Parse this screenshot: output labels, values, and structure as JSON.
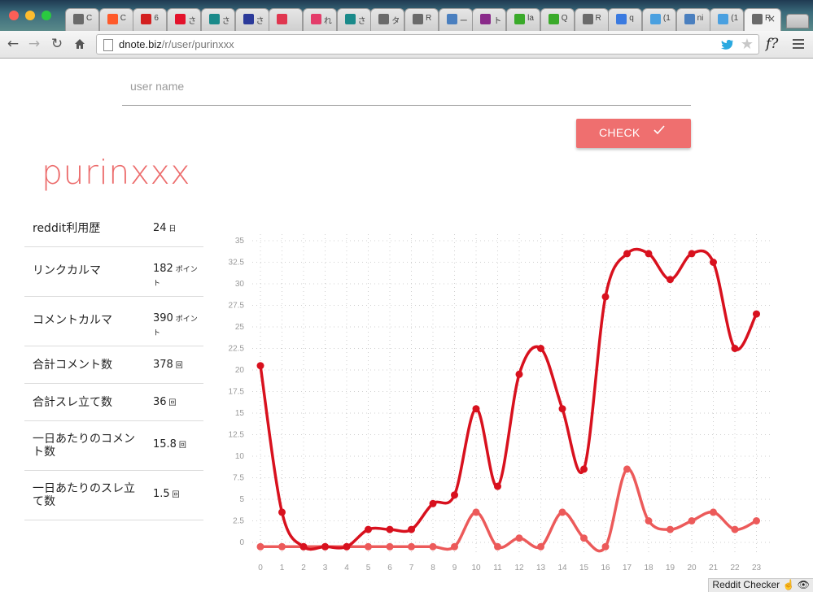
{
  "browser": {
    "tabs": [
      {
        "title": "C",
        "color": "#6a6a6a",
        "icon": "doc-icon"
      },
      {
        "title": "C",
        "color": "#ff5a2a",
        "icon": "slideshare-icon"
      },
      {
        "title": "6",
        "color": "#d31f1f",
        "icon": "flipboard-icon"
      },
      {
        "title": "さ",
        "color": "#e3122b",
        "icon": "red-square-icon"
      },
      {
        "title": "さ",
        "color": "#1a8a8a",
        "icon": "hatena-icon"
      },
      {
        "title": "さ",
        "color": "#2b3a9a",
        "icon": "stripe-icon"
      },
      {
        "title": "",
        "color": "#e0364f",
        "icon": "close-circle-icon"
      },
      {
        "title": "れ",
        "color": "#e43c6a",
        "icon": "bird-icon"
      },
      {
        "title": "さ",
        "color": "#1a8a8a",
        "icon": "hatena-icon"
      },
      {
        "title": "タ",
        "color": "#6a6a6a",
        "icon": "doc-icon"
      },
      {
        "title": "R",
        "color": "#6a6a6a",
        "icon": "doc-icon"
      },
      {
        "title": "ー",
        "color": "#4a7fbf",
        "icon": "reddit-icon"
      },
      {
        "title": "ト",
        "color": "#8a2a8a",
        "icon": "bars-icon"
      },
      {
        "title": "la",
        "color": "#3aaa2a",
        "icon": "qiita-icon"
      },
      {
        "title": "Q",
        "color": "#3aaa2a",
        "icon": "qiita-icon"
      },
      {
        "title": "R",
        "color": "#6a6a6a",
        "icon": "doc-icon"
      },
      {
        "title": "q",
        "color": "#3a7ae0",
        "icon": "google-icon"
      },
      {
        "title": "(1",
        "color": "#4aa0e0",
        "icon": "twitter-icon"
      },
      {
        "title": "ni",
        "color": "#4a7fbf",
        "icon": "reddit-icon"
      },
      {
        "title": "(1",
        "color": "#4aa0e0",
        "icon": "twitter-icon"
      },
      {
        "title": "R",
        "color": "#6a6a6a",
        "icon": "doc-icon",
        "active": true
      }
    ],
    "url_host": "dnote.biz",
    "url_path": "/r/user/purinxxx",
    "ext_label": "f?"
  },
  "form": {
    "placeholder": "user name",
    "value": "",
    "check_label": "CHECK"
  },
  "username": "purinxxx",
  "stats": [
    {
      "label": "reddit利用歴",
      "value": "24",
      "unit": "日"
    },
    {
      "label": "リンクカルマ",
      "value": "182",
      "unit": "ポイント"
    },
    {
      "label": "コメントカルマ",
      "value": "390",
      "unit": "ポイント"
    },
    {
      "label": "合計コメント数",
      "value": "378",
      "unit": "回"
    },
    {
      "label": "合計スレ立て数",
      "value": "36",
      "unit": "回"
    },
    {
      "label": "一日あたりのコメント数",
      "value": "15.8",
      "unit": "回"
    },
    {
      "label": "一日あたりのスレ立て数",
      "value": "1.5",
      "unit": "回"
    }
  ],
  "chart_data": {
    "type": "line",
    "x": [
      0,
      1,
      2,
      3,
      4,
      5,
      6,
      7,
      8,
      9,
      10,
      11,
      12,
      13,
      14,
      15,
      16,
      17,
      18,
      19,
      20,
      21,
      22,
      23
    ],
    "ylim": [
      0,
      35
    ],
    "yticks": [
      "0",
      "2.5",
      "5",
      "7.5",
      "10",
      "12.5",
      "15",
      "17.5",
      "20",
      "22.5",
      "25",
      "27.5",
      "30",
      "32.5",
      "35"
    ],
    "series": [
      {
        "color": "#d8111e",
        "values": [
          20.5,
          3.5,
          -0.5,
          -0.5,
          -0.5,
          1.5,
          1.5,
          1.5,
          4.5,
          5.5,
          15.5,
          6.5,
          19.5,
          22.5,
          15.5,
          8.5,
          28.5,
          33.5,
          33.5,
          30.5,
          33.5,
          32.5,
          22.5,
          26.5
        ]
      },
      {
        "color": "#ec5a5a",
        "values": [
          -0.5,
          -0.5,
          -0.5,
          -0.5,
          -0.5,
          -0.5,
          -0.5,
          -0.5,
          -0.5,
          -0.5,
          3.5,
          -0.5,
          0.5,
          -0.5,
          3.5,
          0.5,
          -0.5,
          8.5,
          2.5,
          1.5,
          2.5,
          3.5,
          1.5,
          2.5
        ]
      }
    ],
    "grid": true
  },
  "statusbar": {
    "label": "Reddit Checker"
  }
}
